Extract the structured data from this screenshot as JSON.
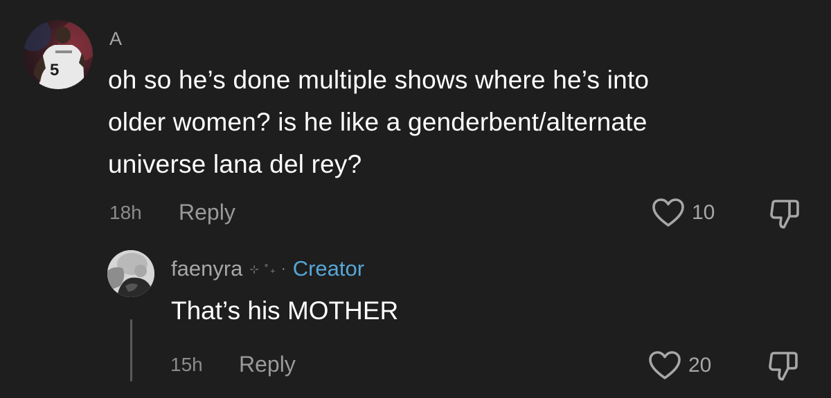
{
  "main_comment": {
    "username": "A",
    "text_lines": [
      "oh so he’s done multiple shows where he’s into",
      "older women? is he like a genderbent/alternate",
      "universe lana del rey?"
    ],
    "time": "18h",
    "reply_label": "Reply",
    "like_count": "10",
    "avatar_jersey_number": "5",
    "icons": {
      "like": "heart-outline-icon",
      "dislike": "thumbs-down-icon"
    }
  },
  "reply_comment": {
    "username": "faenyra",
    "sparkles": "⊹ ˚₊",
    "separator": "·",
    "creator_label": "Creator",
    "text": "That’s his MOTHER",
    "time": "15h",
    "reply_label": "Reply",
    "like_count": "20",
    "icons": {
      "like": "heart-outline-icon",
      "dislike": "thumbs-down-icon"
    }
  },
  "colors": {
    "background": "#1e1e1e",
    "primary_text": "#ffffff",
    "secondary_text": "#a7a7a7",
    "creator_accent": "#57a6d8",
    "thread_line": "#5a5a5a"
  }
}
